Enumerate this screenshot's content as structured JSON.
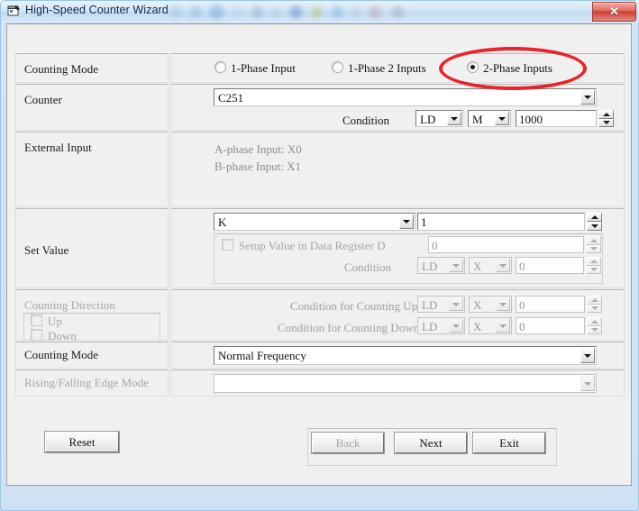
{
  "window": {
    "title": "High-Speed Counter Wizard",
    "close_label": "✕",
    "app_icon": "app-window-icon",
    "ghost_icons": [
      "ghost-icon-1",
      "ghost-icon-2",
      "ghost-icon-3",
      "ghost-icon-4",
      "ghost-icon-5",
      "ghost-icon-6",
      "ghost-icon-7",
      "ghost-icon-8",
      "ghost-icon-9",
      "ghost-icon-10",
      "ghost-icon-11",
      "ghost-icon-12"
    ]
  },
  "colors": {
    "titlebar": "#d2e6f7",
    "window_border": "#9cc4e4",
    "client_bg": "#f0f0f0",
    "annotation": "#e8232a",
    "close_button": "#cf3f33",
    "disabled_text": "#a6a6a6"
  },
  "rows": {
    "counting_mode_top": {
      "label": "Counting Mode"
    },
    "counter": {
      "label": "Counter"
    },
    "external_input": {
      "label": "External Input"
    },
    "set_value": {
      "label": "Set Value"
    },
    "counting_direction": {
      "label": "Counting Direction"
    },
    "counting_mode_bottom": {
      "label": "Counting Mode"
    },
    "edge_mode": {
      "label": "Rising/Falling Edge Mode"
    }
  },
  "mode_radios": [
    {
      "label": "1-Phase Input",
      "checked": false
    },
    {
      "label": "1-Phase 2 Inputs",
      "checked": false
    },
    {
      "label": "2-Phase Inputs",
      "checked": true
    }
  ],
  "counter": {
    "value": "C251",
    "condition_label": "Condition",
    "cond_op": "LD",
    "cond_dev": "M",
    "cond_num": "1000"
  },
  "external_input": {
    "line1": "A-phase Input: X0",
    "line2": "B-phase Input: X1"
  },
  "set_value": {
    "type": "K",
    "value": "1",
    "register_checkbox_label": "Setup Value in Data Register D",
    "register_checked": false,
    "register_value": "0",
    "condition_label": "Condition",
    "cond_op": "LD",
    "cond_dev": "X",
    "cond_num": "0"
  },
  "counting_direction": {
    "up_label": "Up",
    "up_checked": false,
    "down_label": "Down",
    "down_checked": false,
    "up_cond_label": "Condition for Counting Up",
    "up_cond_op": "LD",
    "up_cond_dev": "X",
    "up_cond_num": "0",
    "down_cond_label": "Condition for Counting Down",
    "down_cond_op": "LD",
    "down_cond_dev": "X",
    "down_cond_num": "0"
  },
  "counting_mode": {
    "value": "Normal Frequency"
  },
  "edge_mode": {
    "value": ""
  },
  "buttons": {
    "reset": "Reset",
    "back": "Back",
    "next": "Next",
    "exit": "Exit"
  }
}
